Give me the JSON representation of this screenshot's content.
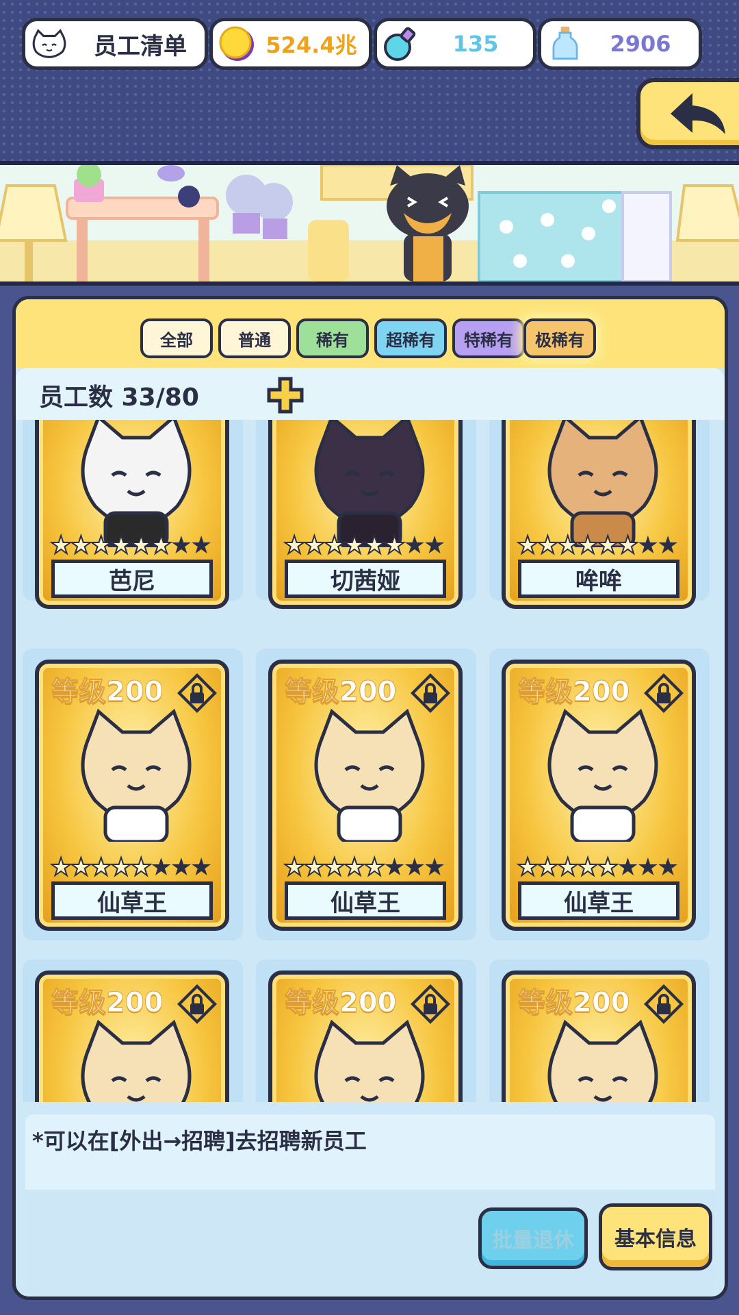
{
  "header": {
    "title": "员工清单",
    "gold": "524.4兆",
    "flask": "135",
    "bottle": "2906"
  },
  "tabs": [
    "全部",
    "普通",
    "稀有",
    "超稀有",
    "特稀有",
    "极稀有"
  ],
  "staff": {
    "count_label": "员工数 33/80"
  },
  "cards": [
    {
      "name": "芭尼",
      "level": "",
      "stars_on": 6,
      "stars_total": 8
    },
    {
      "name": "切茜娅",
      "level": "",
      "stars_on": 6,
      "stars_total": 8
    },
    {
      "name": "哞哞",
      "level": "",
      "stars_on": 6,
      "stars_total": 8
    },
    {
      "name": "仙草王",
      "level": "等级200",
      "stars_on": 5,
      "stars_total": 8
    },
    {
      "name": "仙草王",
      "level": "等级200",
      "stars_on": 5,
      "stars_total": 8
    },
    {
      "name": "仙草王",
      "level": "等级200",
      "stars_on": 5,
      "stars_total": 8
    },
    {
      "name": "",
      "level": "等级200",
      "stars_on": 0,
      "stars_total": 0
    },
    {
      "name": "",
      "level": "等级200",
      "stars_on": 0,
      "stars_total": 0
    },
    {
      "name": "",
      "level": "等级200",
      "stars_on": 0,
      "stars_total": 0
    }
  ],
  "footer": {
    "hint": "*可以在[外出→招聘]去招聘新员工",
    "retire_label": "批量退休",
    "info_label": "基本信息"
  },
  "colors": {
    "accent_yellow": "#fde37a",
    "frame_dark": "#2b2f45",
    "card_gold": "#f7c640",
    "panel_blue": "#cfe8f8"
  }
}
